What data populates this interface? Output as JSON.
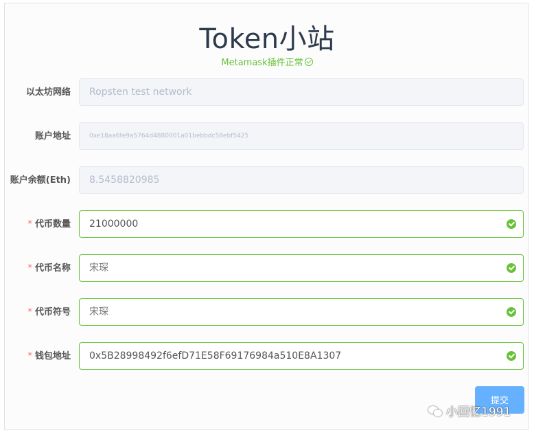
{
  "app": {
    "title": "Token小站",
    "status_text": "Metamask插件正常"
  },
  "form": {
    "network": {
      "label": "以太坊网络",
      "value": "Ropsten test network"
    },
    "account_address": {
      "label": "账户地址",
      "value": "0xe18aa6fe9a5764d4880001a01bebbdc58ebf5425"
    },
    "account_balance": {
      "label": "账户余额(Eth)",
      "value": "8.5458820985"
    },
    "token_amount": {
      "label": "代币数量",
      "required_mark": "*",
      "value": "21000000"
    },
    "token_name": {
      "label": "代币名称",
      "required_mark": "*",
      "value": "宋琛"
    },
    "token_symbol": {
      "label": "代币符号",
      "required_mark": "*",
      "value": "宋琛"
    },
    "wallet_address": {
      "label": "钱包地址",
      "required_mark": "*",
      "value": "0x5B28998492f6efD71E58F69176984a510E8A1307"
    },
    "submit_label": "提交"
  },
  "watermark": {
    "text": "小回忆1991",
    "icon": "wechat-icon"
  },
  "colors": {
    "success": "#67c23a",
    "required": "#f56c6c",
    "primary_button": "#66b1ff",
    "title": "#2d3a4b",
    "disabled_bg": "#f3f5f8"
  }
}
